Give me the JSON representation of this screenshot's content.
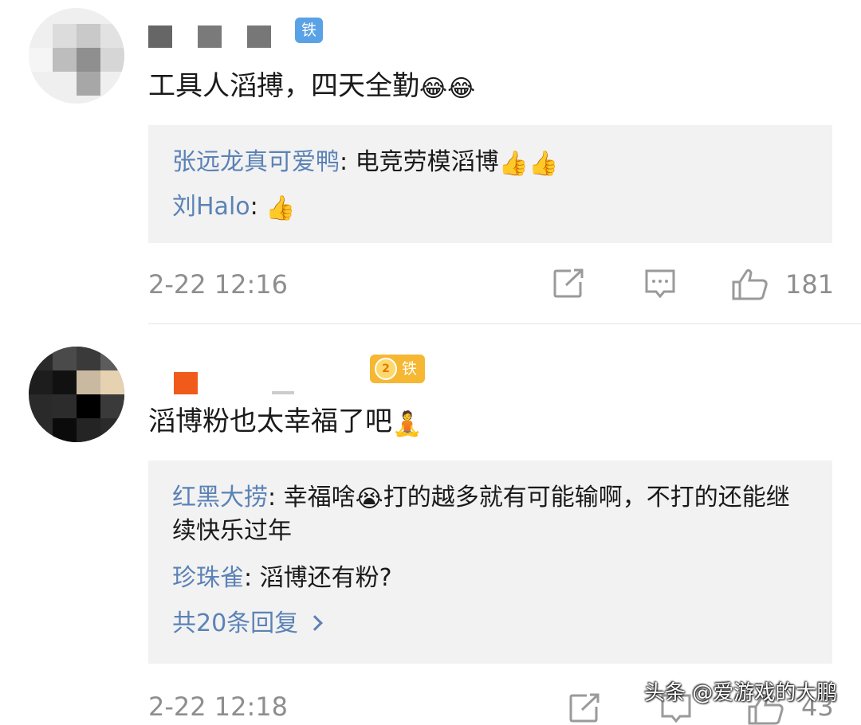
{
  "comments": [
    {
      "badge": "铁粉",
      "content": "工具人滔搏，四天全勤",
      "content_emojis": [
        "😂",
        "😂"
      ],
      "replies": [
        {
          "user": "张远龙真可爱鸭",
          "text": "电竞劳模滔博",
          "emojis": [
            "👍",
            "👍"
          ]
        },
        {
          "user": "刘Halo",
          "text": "",
          "emojis": [
            "👍"
          ]
        }
      ],
      "time": "2-22 12:16",
      "likes": "181"
    },
    {
      "badge": "铁粉",
      "badge_level": "2",
      "content": "滔博粉也太幸福了吧",
      "content_emojis": [
        "🧘"
      ],
      "replies": [
        {
          "user": "红黑大捞",
          "text_before": "幸福啥",
          "emoji": "😭",
          "text_after": "打的越多就有可能输啊，不打的还能继续快乐过年"
        },
        {
          "user": "珍珠雀",
          "text": "滔博还有粉?"
        }
      ],
      "more_replies": "共20条回复",
      "time": "2-22 12:18",
      "likes": "43"
    }
  ],
  "watermark": "头条 @爱游戏的大鹏",
  "icons": [
    "share-icon",
    "comment-icon",
    "like-icon",
    "chevron-right-icon"
  ],
  "colors": {
    "reply_user": "#5b82b6",
    "badge_blue": "#5aa2e6",
    "badge_gold": "#f6b733",
    "meta": "#8e8e8e",
    "reply_bg": "#f2f2f2"
  }
}
